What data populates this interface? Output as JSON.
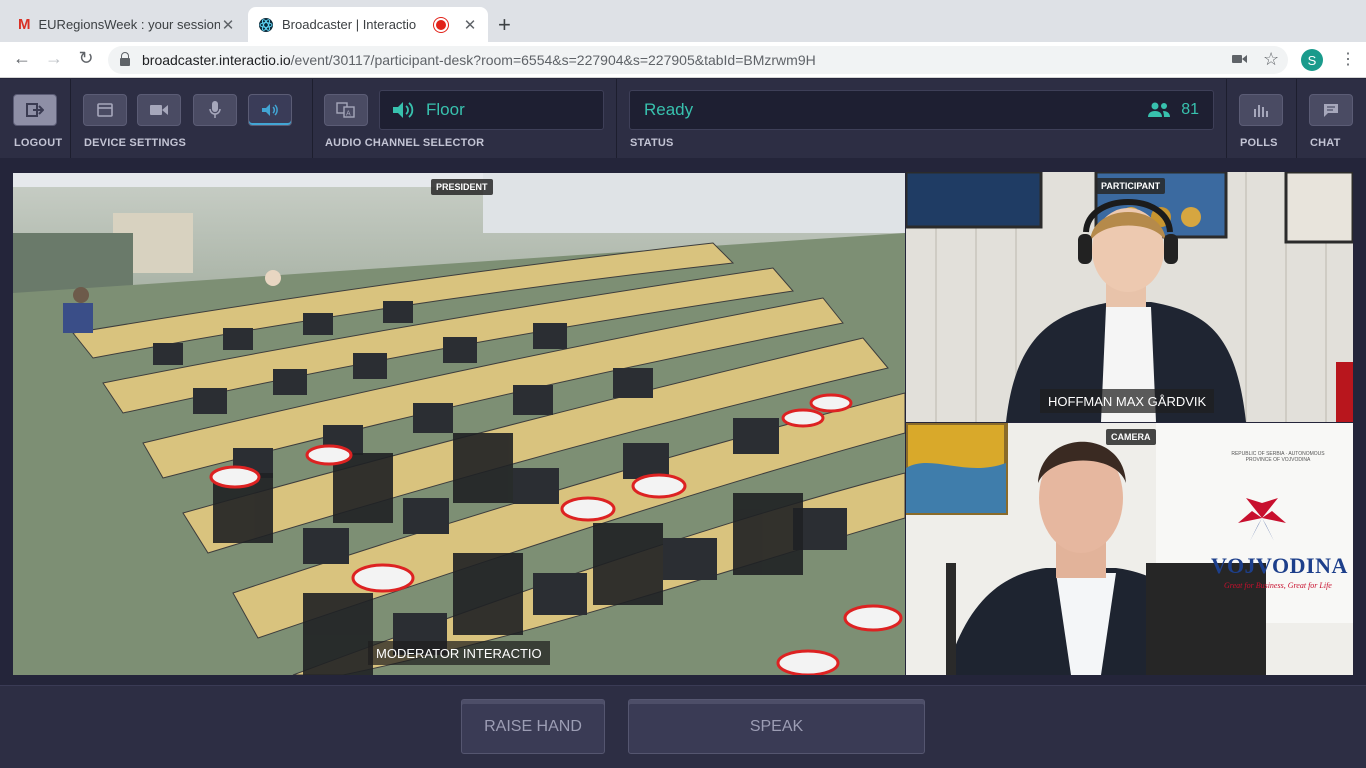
{
  "browser": {
    "tabs": [
      {
        "title": "EURegionsWeek : your session",
        "icon": "gmail-icon"
      },
      {
        "title": "Broadcaster | Interactio",
        "icon": "react-icon"
      }
    ],
    "url_host": "broadcaster.interactio.io",
    "url_path": "/event/30117/participant-desk?room=6554&s=227904&s=227905&tabId=BMzrwm9H",
    "profile_initial": "S"
  },
  "toolbar": {
    "logout_label": "LOGOUT",
    "device_settings_label": "DEVICE SETTINGS",
    "audio_channel_selector_label": "AUDIO CHANNEL SELECTOR",
    "audio_channel_value": "Floor",
    "status_label": "STATUS",
    "status_value": "Ready",
    "participant_count": "81",
    "polls_label": "POLLS",
    "chat_label": "CHAT"
  },
  "videos": {
    "main": {
      "role": "PRESIDENT",
      "name": "MODERATOR INTERACTIO"
    },
    "top_right": {
      "role": "PARTICIPANT",
      "name": "HOFFMAN MAX GÅRDVIK"
    },
    "bottom_right": {
      "role": "CAMERA",
      "banner_title": "VOJVODINA",
      "banner_tagline": "Great for Business, Great for Life",
      "banner_small": "REPUBLIC OF SERBIA · AUTONOMOUS PROVINCE OF VOJVODINA"
    }
  },
  "actions": {
    "raise_hand_label": "RAISE HAND",
    "speak_label": "SPEAK"
  },
  "colors": {
    "accent": "#38c1ae",
    "toolbar_bg": "#2d2e44",
    "active_underline": "#42a5d4"
  }
}
